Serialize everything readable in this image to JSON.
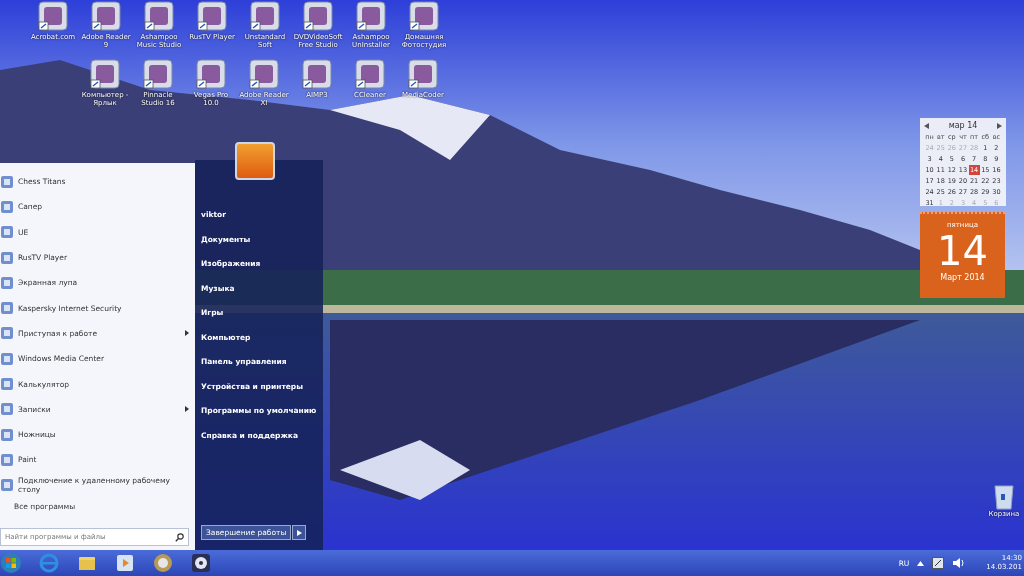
{
  "desktop_icons_row_1": [
    {
      "label": "Acrobat.com"
    },
    {
      "label": "Adobe Reader 9"
    },
    {
      "label": "Ashampoo Music Studio"
    },
    {
      "label": "RusTV Player"
    },
    {
      "label": "Unstandard Soft"
    },
    {
      "label": "DVDVideoSoft Free Studio"
    },
    {
      "label": "Ashampoo UnInstaller"
    },
    {
      "label": "Домашняя Фотостудия"
    }
  ],
  "desktop_icons_row_2": [
    {
      "label": "Компьютер - Ярлык"
    },
    {
      "label": "Pinnacle Studio 16"
    },
    {
      "label": "Vegas Pro 10.0"
    },
    {
      "label": "Adobe Reader XI"
    },
    {
      "label": "AIMP3"
    },
    {
      "label": "CCleaner"
    },
    {
      "label": "MediaCoder"
    }
  ],
  "start_menu": {
    "programs": [
      {
        "label": "Chess Titans",
        "has_submenu": false
      },
      {
        "label": "Сапер",
        "has_submenu": false
      },
      {
        "label": "UE",
        "has_submenu": false
      },
      {
        "label": "RusTV Player",
        "has_submenu": false
      },
      {
        "label": "Экранная лупа",
        "has_submenu": false
      },
      {
        "label": "Kaspersky Internet Security",
        "has_submenu": false
      },
      {
        "label": "Приступая к работе",
        "has_submenu": true
      },
      {
        "label": "Windows Media Center",
        "has_submenu": false
      },
      {
        "label": "Калькулятор",
        "has_submenu": false
      },
      {
        "label": "Записки",
        "has_submenu": true
      },
      {
        "label": "Ножницы",
        "has_submenu": false
      },
      {
        "label": "Paint",
        "has_submenu": false
      },
      {
        "label": "Подключение к удаленному рабочему столу",
        "has_submenu": false
      }
    ],
    "all_programs": "Все программы",
    "search": {
      "placeholder": "Найти программы и файлы"
    },
    "places": [
      "viktor",
      "Документы",
      "Изображения",
      "Музыка",
      "Игры",
      "Компьютер",
      "Панель управления",
      "Устройства и принтеры",
      "Программы по умолчанию",
      "Справка и поддержка"
    ],
    "shutdown_button": "Завершение работы"
  },
  "calendar_gadget": {
    "month": "мар 14",
    "weekdays": [
      "пн",
      "вт",
      "ср",
      "чт",
      "пт",
      "сб",
      "вс"
    ],
    "weeks": [
      [
        {
          "day": "24",
          "other_month": true,
          "selected": false
        },
        {
          "day": "25",
          "other_month": true,
          "selected": false
        },
        {
          "day": "26",
          "other_month": true,
          "selected": false
        },
        {
          "day": "27",
          "other_month": true,
          "selected": false
        },
        {
          "day": "28",
          "other_month": true,
          "selected": false
        },
        {
          "day": "1",
          "other_month": false,
          "selected": false
        },
        {
          "day": "2",
          "other_month": false,
          "selected": false
        }
      ],
      [
        {
          "day": "3",
          "other_month": false,
          "selected": false
        },
        {
          "day": "4",
          "other_month": false,
          "selected": false
        },
        {
          "day": "5",
          "other_month": false,
          "selected": false
        },
        {
          "day": "6",
          "other_month": false,
          "selected": false
        },
        {
          "day": "7",
          "other_month": false,
          "selected": false
        },
        {
          "day": "8",
          "other_month": false,
          "selected": false
        },
        {
          "day": "9",
          "other_month": false,
          "selected": false
        }
      ],
      [
        {
          "day": "10",
          "other_month": false,
          "selected": false
        },
        {
          "day": "11",
          "other_month": false,
          "selected": false
        },
        {
          "day": "12",
          "other_month": false,
          "selected": false
        },
        {
          "day": "13",
          "other_month": false,
          "selected": false
        },
        {
          "day": "14",
          "other_month": false,
          "selected": true
        },
        {
          "day": "15",
          "other_month": false,
          "selected": false
        },
        {
          "day": "16",
          "other_month": false,
          "selected": false
        }
      ],
      [
        {
          "day": "17",
          "other_month": false,
          "selected": false
        },
        {
          "day": "18",
          "other_month": false,
          "selected": false
        },
        {
          "day": "19",
          "other_month": false,
          "selected": false
        },
        {
          "day": "20",
          "other_month": false,
          "selected": false
        },
        {
          "day": "21",
          "other_month": false,
          "selected": false
        },
        {
          "day": "22",
          "other_month": false,
          "selected": false
        },
        {
          "day": "23",
          "other_month": false,
          "selected": false
        }
      ],
      [
        {
          "day": "24",
          "other_month": false,
          "selected": false
        },
        {
          "day": "25",
          "other_month": false,
          "selected": false
        },
        {
          "day": "26",
          "other_month": false,
          "selected": false
        },
        {
          "day": "27",
          "other_month": false,
          "selected": false
        },
        {
          "day": "28",
          "other_month": false,
          "selected": false
        },
        {
          "day": "29",
          "other_month": false,
          "selected": false
        },
        {
          "day": "30",
          "other_month": false,
          "selected": false
        }
      ],
      [
        {
          "day": "31",
          "other_month": false,
          "selected": false
        },
        {
          "day": "1",
          "other_month": true,
          "selected": false
        },
        {
          "day": "2",
          "other_month": true,
          "selected": false
        },
        {
          "day": "3",
          "other_month": true,
          "selected": false
        },
        {
          "day": "4",
          "other_month": true,
          "selected": false
        },
        {
          "day": "5",
          "other_month": true,
          "selected": false
        },
        {
          "day": "6",
          "other_month": true,
          "selected": false
        }
      ]
    ]
  },
  "date_gadget": {
    "weekday": "пятница",
    "day": "14",
    "month_year": "Март 2014"
  },
  "recycle_bin": {
    "label": "Корзина"
  },
  "taskbar": {
    "language": "RU",
    "time": "14:30",
    "date": "14.03.201"
  }
}
